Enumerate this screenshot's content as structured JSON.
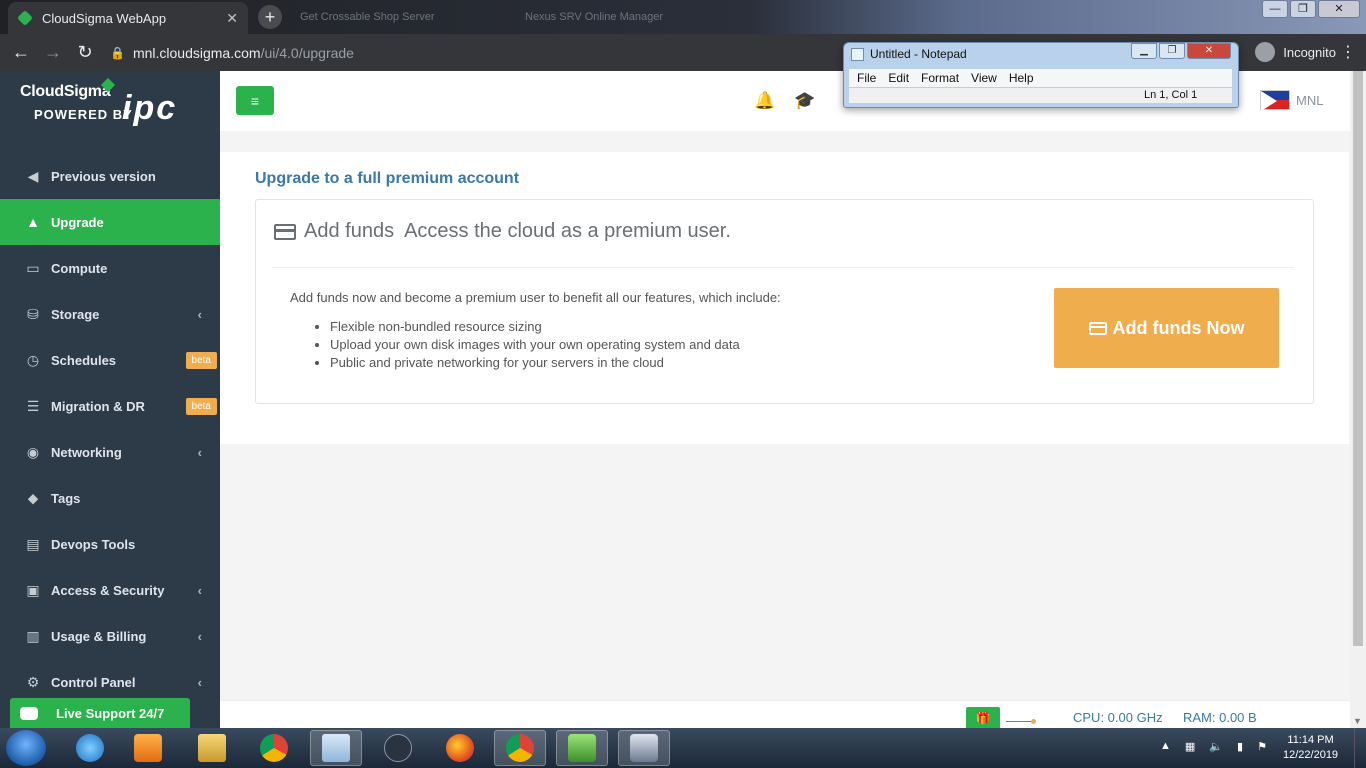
{
  "browser": {
    "tab_title": "CloudSigma WebApp",
    "tab_close": "✕",
    "new_tab": "+",
    "ghost_tab_1": "Get Crossable Shop Server",
    "ghost_tab_2": "Nexus SRV Online Manager",
    "url_host": "mnl.cloudsigma.com",
    "url_path": "/ui/4.0/upgrade",
    "profile_label": "Incognito",
    "window_controls": [
      "—",
      "❐",
      "✕"
    ]
  },
  "sidebar": {
    "brand": "CloudSigma",
    "powered_by": "POWERED BY",
    "partner": "ipc",
    "items": [
      {
        "label": "Previous version",
        "icon": "arrow-circle-left-icon",
        "glyph": "◀",
        "active": false,
        "chevron": "",
        "badge": ""
      },
      {
        "label": "Upgrade",
        "icon": "chevron-up-icon",
        "glyph": "▲",
        "active": true,
        "chevron": "",
        "badge": ""
      },
      {
        "label": "Compute",
        "icon": "monitor-icon",
        "glyph": "▭",
        "active": false,
        "chevron": "",
        "badge": ""
      },
      {
        "label": "Storage",
        "icon": "drive-icon",
        "glyph": "⛁",
        "active": false,
        "chevron": "‹",
        "badge": ""
      },
      {
        "label": "Schedules",
        "icon": "clock-icon",
        "glyph": "◷",
        "active": false,
        "chevron": "",
        "badge": "beta"
      },
      {
        "label": "Migration & DR",
        "icon": "server-icon",
        "glyph": "☰",
        "active": false,
        "chevron": "",
        "badge": "beta"
      },
      {
        "label": "Networking",
        "icon": "globe-icon",
        "glyph": "◉",
        "active": false,
        "chevron": "‹",
        "badge": ""
      },
      {
        "label": "Tags",
        "icon": "tags-icon",
        "glyph": "⬥",
        "active": false,
        "chevron": "",
        "badge": ""
      },
      {
        "label": "Devops Tools",
        "icon": "list-icon",
        "glyph": "▤",
        "active": false,
        "chevron": "",
        "badge": ""
      },
      {
        "label": "Access & Security",
        "icon": "lock-icon",
        "glyph": "▣",
        "active": false,
        "chevron": "‹",
        "badge": ""
      },
      {
        "label": "Usage & Billing",
        "icon": "bar-chart-icon",
        "glyph": "▥",
        "active": false,
        "chevron": "‹",
        "badge": ""
      },
      {
        "label": "Control Panel",
        "icon": "cogs-icon",
        "glyph": "⚙",
        "active": false,
        "chevron": "‹",
        "badge": ""
      }
    ],
    "live_support": "Live Support 24/7"
  },
  "header": {
    "menu_glyph": "≡",
    "bell_glyph": "🔔",
    "education_glyph": "🎓",
    "location": "MNL"
  },
  "main": {
    "title": "Upgrade to a full premium account",
    "heading": "Add funds",
    "subheading": "Access the cloud as a premium user.",
    "intro": "Add funds now and become a premium user to benefit all our features, which include:",
    "features": [
      "Flexible non-bundled resource sizing",
      "Upload your own disk images with your own operating system and data",
      "Public and private networking for your servers in the cloud"
    ],
    "cta_label": "Add funds Now"
  },
  "footer": {
    "gift_glyph": "🎁",
    "cpu": "CPU: 0.00 GHz",
    "ram": "RAM: 0.00 B"
  },
  "notepad": {
    "title": "Untitled - Notepad",
    "menu": [
      "File",
      "Edit",
      "Format",
      "View",
      "Help"
    ],
    "status": "Ln 1, Col 1",
    "controls": [
      "▁",
      "❐",
      "✕"
    ]
  },
  "taskbar": {
    "apps": [
      "internet-explorer",
      "media-player",
      "file-explorer",
      "chrome",
      "notepad",
      "nox",
      "firefox",
      "chrome",
      "app-green",
      "app-robot"
    ],
    "time": "11:14 PM",
    "date": "12/22/2019",
    "tray_glyphs": [
      "▲",
      "▦",
      "🔈",
      "▮",
      "⚑"
    ]
  },
  "colors": {
    "accent_green": "#2bb24c",
    "sidebar_bg": "#2d3a48",
    "cta_orange": "#f0ad4e",
    "link_blue": "#3a78a6"
  }
}
